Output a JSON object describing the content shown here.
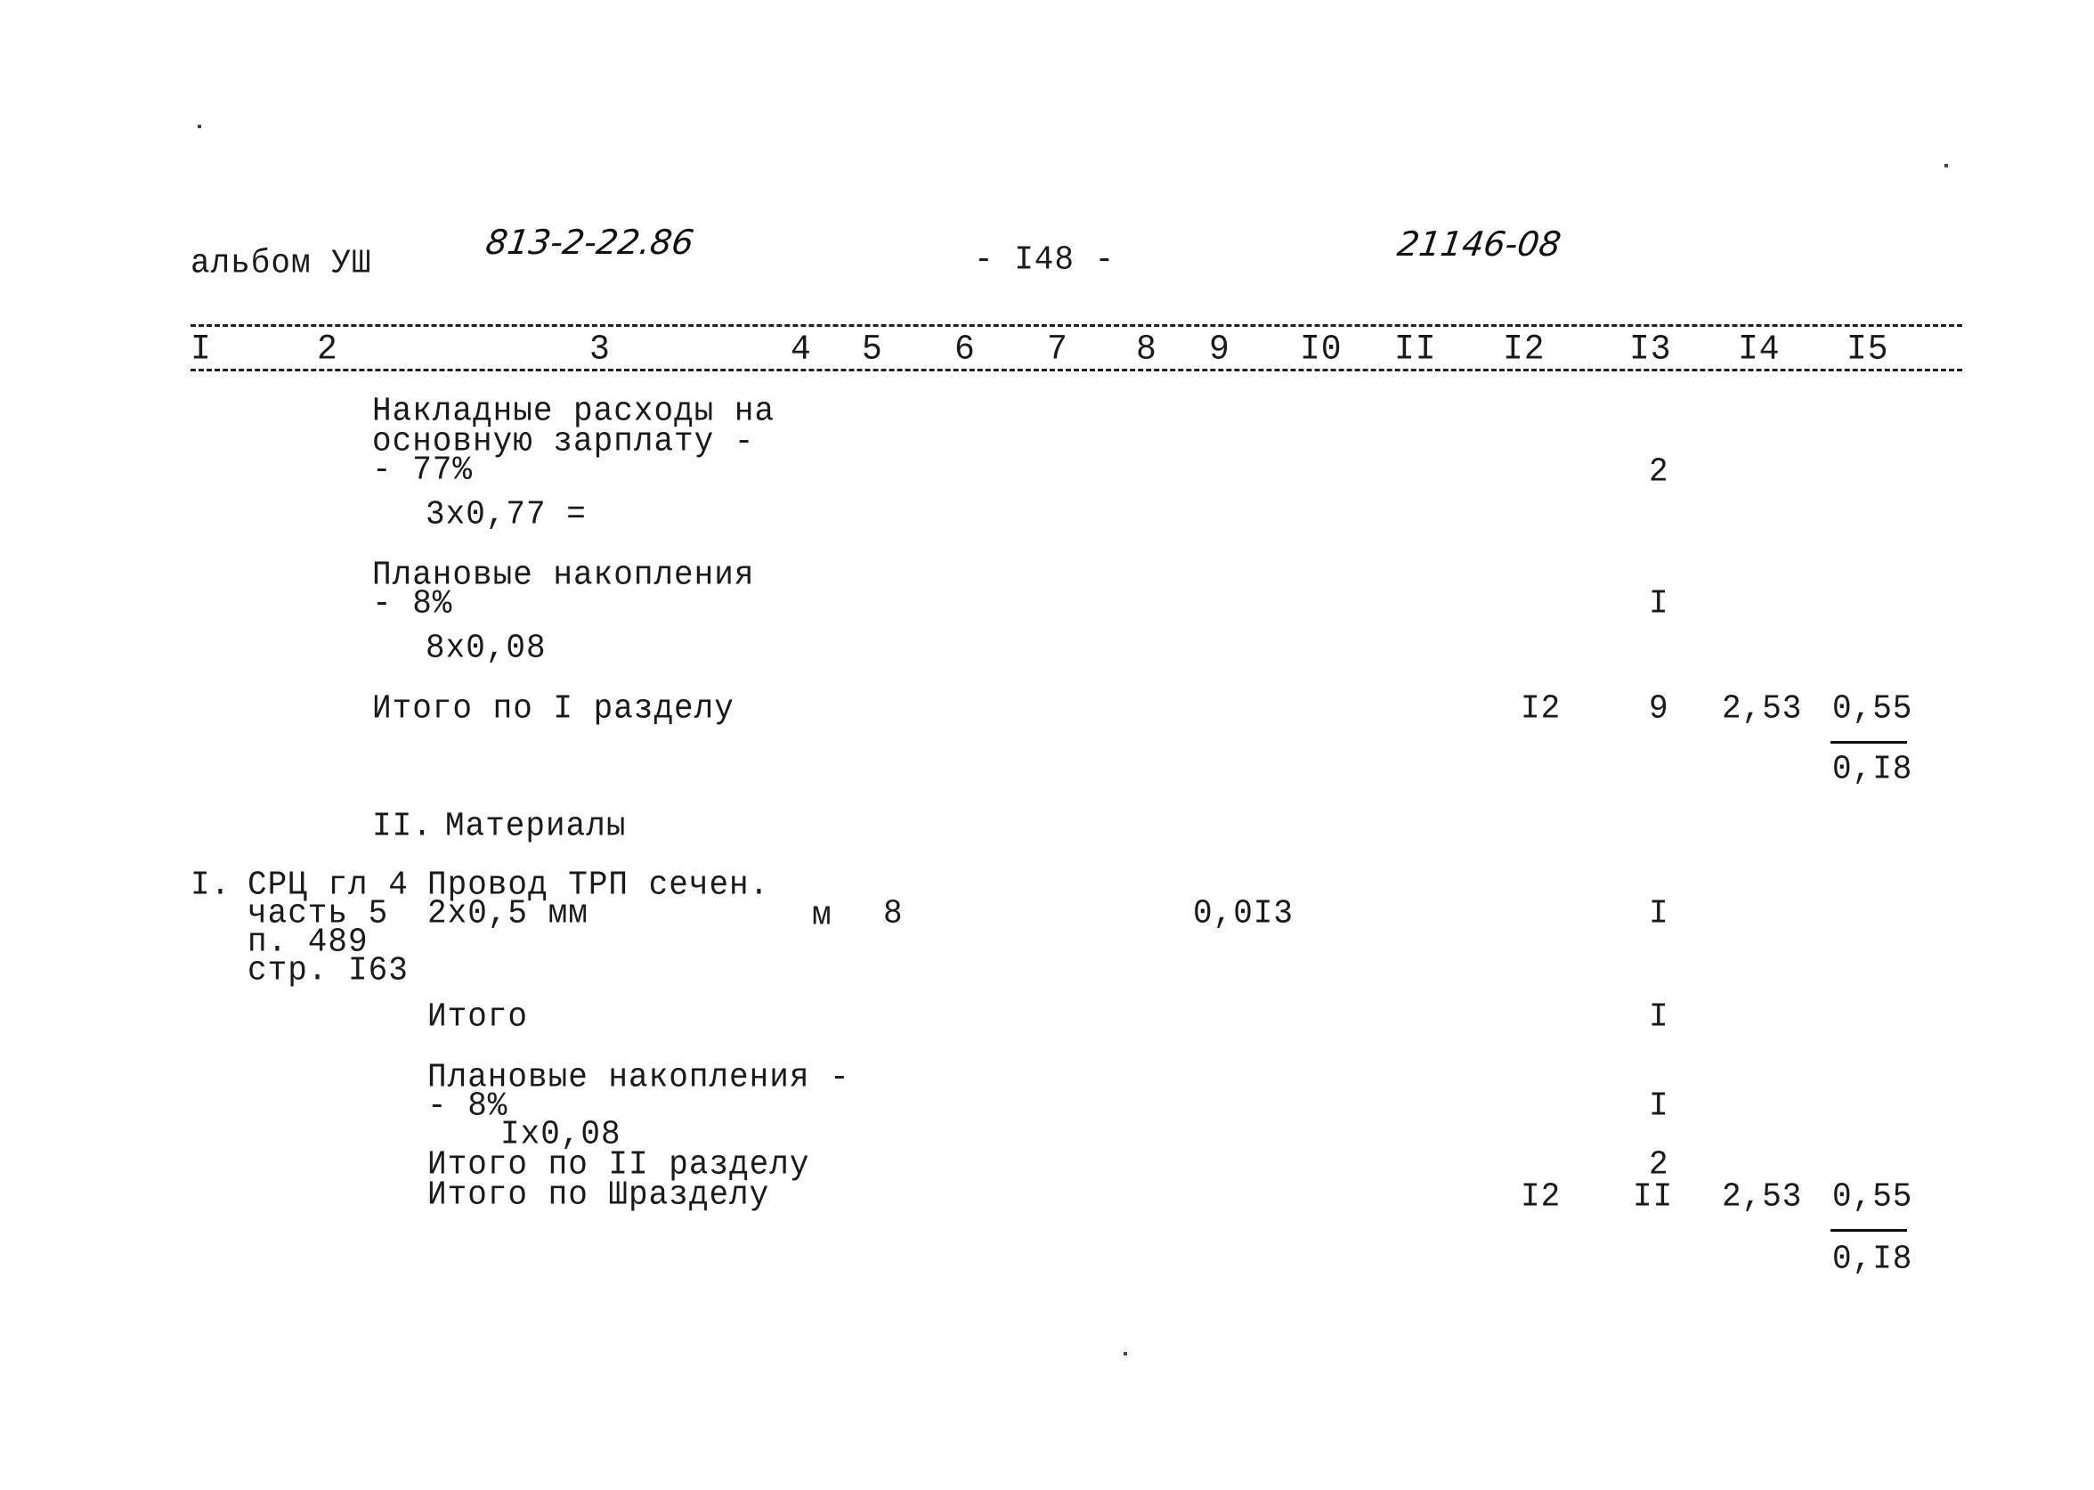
{
  "header": {
    "album": "альбом УШ",
    "project_code": "813-2-22.86",
    "page_number": "- I48 -",
    "doc_number": "21146-08"
  },
  "column_numbers": [
    "I",
    "2",
    "3",
    "4",
    "5",
    "6",
    "7",
    "8",
    "9",
    "I0",
    "II",
    "I2",
    "I3",
    "I4",
    "I5"
  ],
  "section1": {
    "overhead": {
      "label_line1": "Накладные расходы на",
      "label_line2": "основную зарплату -",
      "label_line3": "- 77%",
      "formula": "3x0,77 =",
      "col13": "2"
    },
    "planned_savings": {
      "label_line1": "Плановые накопления",
      "label_line2": "- 8%",
      "formula": "8x0,08",
      "col13": "I"
    },
    "total": {
      "label": "Итого по I разделу",
      "col12": "I2",
      "col13": "9",
      "col14": "2,53",
      "col15_top": "0,55",
      "col15_bottom": "0,I8"
    }
  },
  "section2": {
    "title_num": "II.",
    "title": "Материалы",
    "item": {
      "num": "I.",
      "ref_line1": "СРЦ гл 4",
      "ref_line2": "часть 5",
      "ref_line3": "п. 489",
      "ref_line4": "стр. I63",
      "name_line1": "Провод ТРП сечен.",
      "name_line2": "2x0,5 мм",
      "unit": "м",
      "qty": "8",
      "col9": "0,0I3",
      "col13": "I"
    },
    "subtotal": {
      "label": "Итого",
      "col13": "I"
    },
    "planned_savings": {
      "label_line1": "Плановые накопления -",
      "label_line2": "- 8%",
      "formula": "Ix0,08",
      "col13": "I"
    },
    "total": {
      "label": "Итого по II разделу",
      "col13": "2"
    },
    "total3": {
      "label": "Итого по Шразделу",
      "col12": "I2",
      "col13": "II",
      "col14": "2,53",
      "col15_top": "0,55",
      "col15_bottom": "0,I8"
    }
  }
}
